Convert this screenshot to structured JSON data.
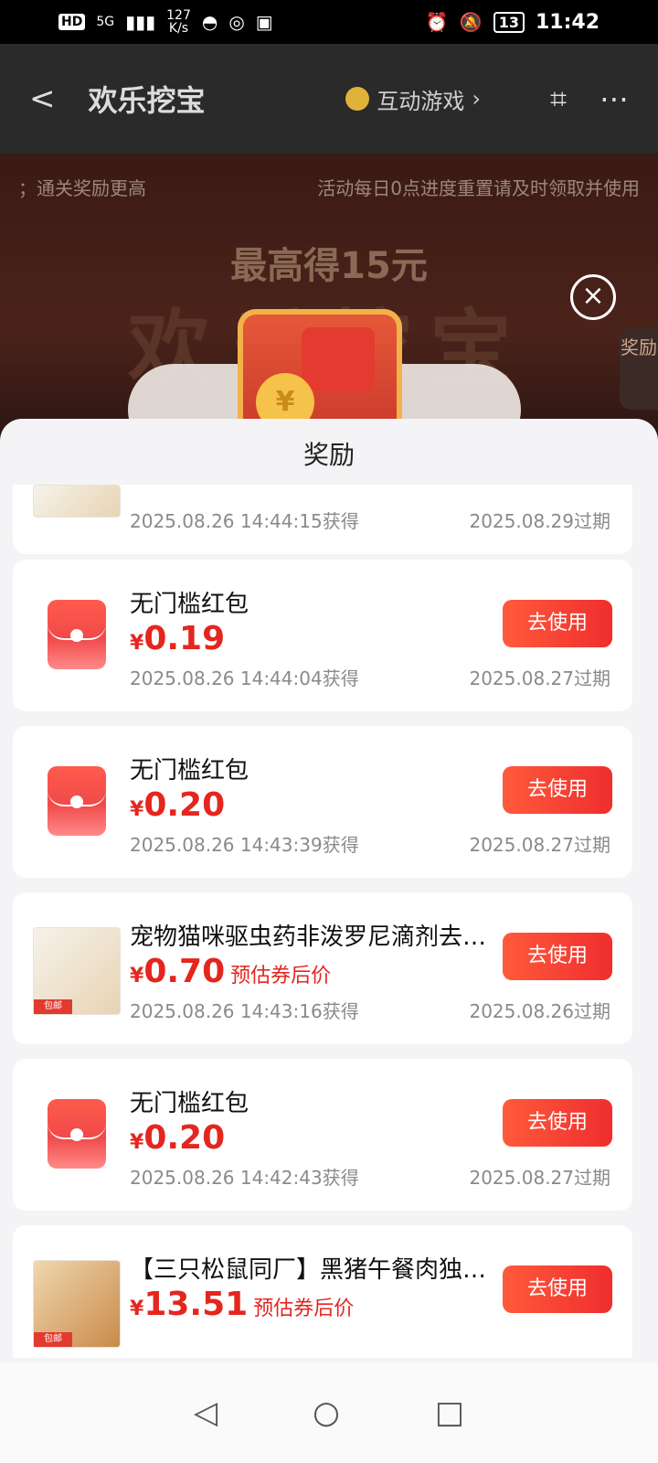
{
  "status_bar": {
    "hd": "HD",
    "net": "5G",
    "speed": "127",
    "speed_unit": "K/s",
    "battery": "13",
    "time": "11:42"
  },
  "header": {
    "back": "<",
    "title": "欢乐挖宝",
    "game_link": "互动游戏",
    "chevron": "›"
  },
  "banner": {
    "notice_left": "；通关奖励更高",
    "notice_right": "活动每日0点进度重置请及时领取并使用",
    "promo": "最高得15元",
    "big_title": "欢乐挖宝",
    "side_tab": "奖励",
    "close": "×"
  },
  "sheet": {
    "title": "奖励",
    "items": [
      {
        "name": "",
        "yen": "",
        "amount": "",
        "note": "",
        "got": "2025.08.26 14:44:15获得",
        "exp": "2025.08.29过期",
        "button": "",
        "type": "product"
      },
      {
        "name": "无门槛红包",
        "yen": "¥",
        "amount": "0.19",
        "note": "",
        "got": "2025.08.26 14:44:04获得",
        "exp": "2025.08.27过期",
        "button": "去使用",
        "type": "envelope"
      },
      {
        "name": "无门槛红包",
        "yen": "¥",
        "amount": "0.20",
        "note": "",
        "got": "2025.08.26 14:43:39获得",
        "exp": "2025.08.27过期",
        "button": "去使用",
        "type": "envelope"
      },
      {
        "name": "宠物猫咪驱虫药非泼罗尼滴剂去…",
        "yen": "¥",
        "amount": "0.70",
        "note": "预估券后价",
        "got": "2025.08.26 14:43:16获得",
        "exp": "2025.08.26过期",
        "button": "去使用",
        "type": "product"
      },
      {
        "name": "无门槛红包",
        "yen": "¥",
        "amount": "0.20",
        "note": "",
        "got": "2025.08.26 14:42:43获得",
        "exp": "2025.08.27过期",
        "button": "去使用",
        "type": "envelope"
      },
      {
        "name": "【三只松鼠同厂】黑猪午餐肉独…",
        "yen": "¥",
        "amount": "13.51",
        "note": "预估券后价",
        "got": "",
        "exp": "",
        "button": "去使用",
        "type": "product"
      }
    ]
  },
  "nav": {
    "back": "◁",
    "home": "○",
    "recent": "□"
  }
}
